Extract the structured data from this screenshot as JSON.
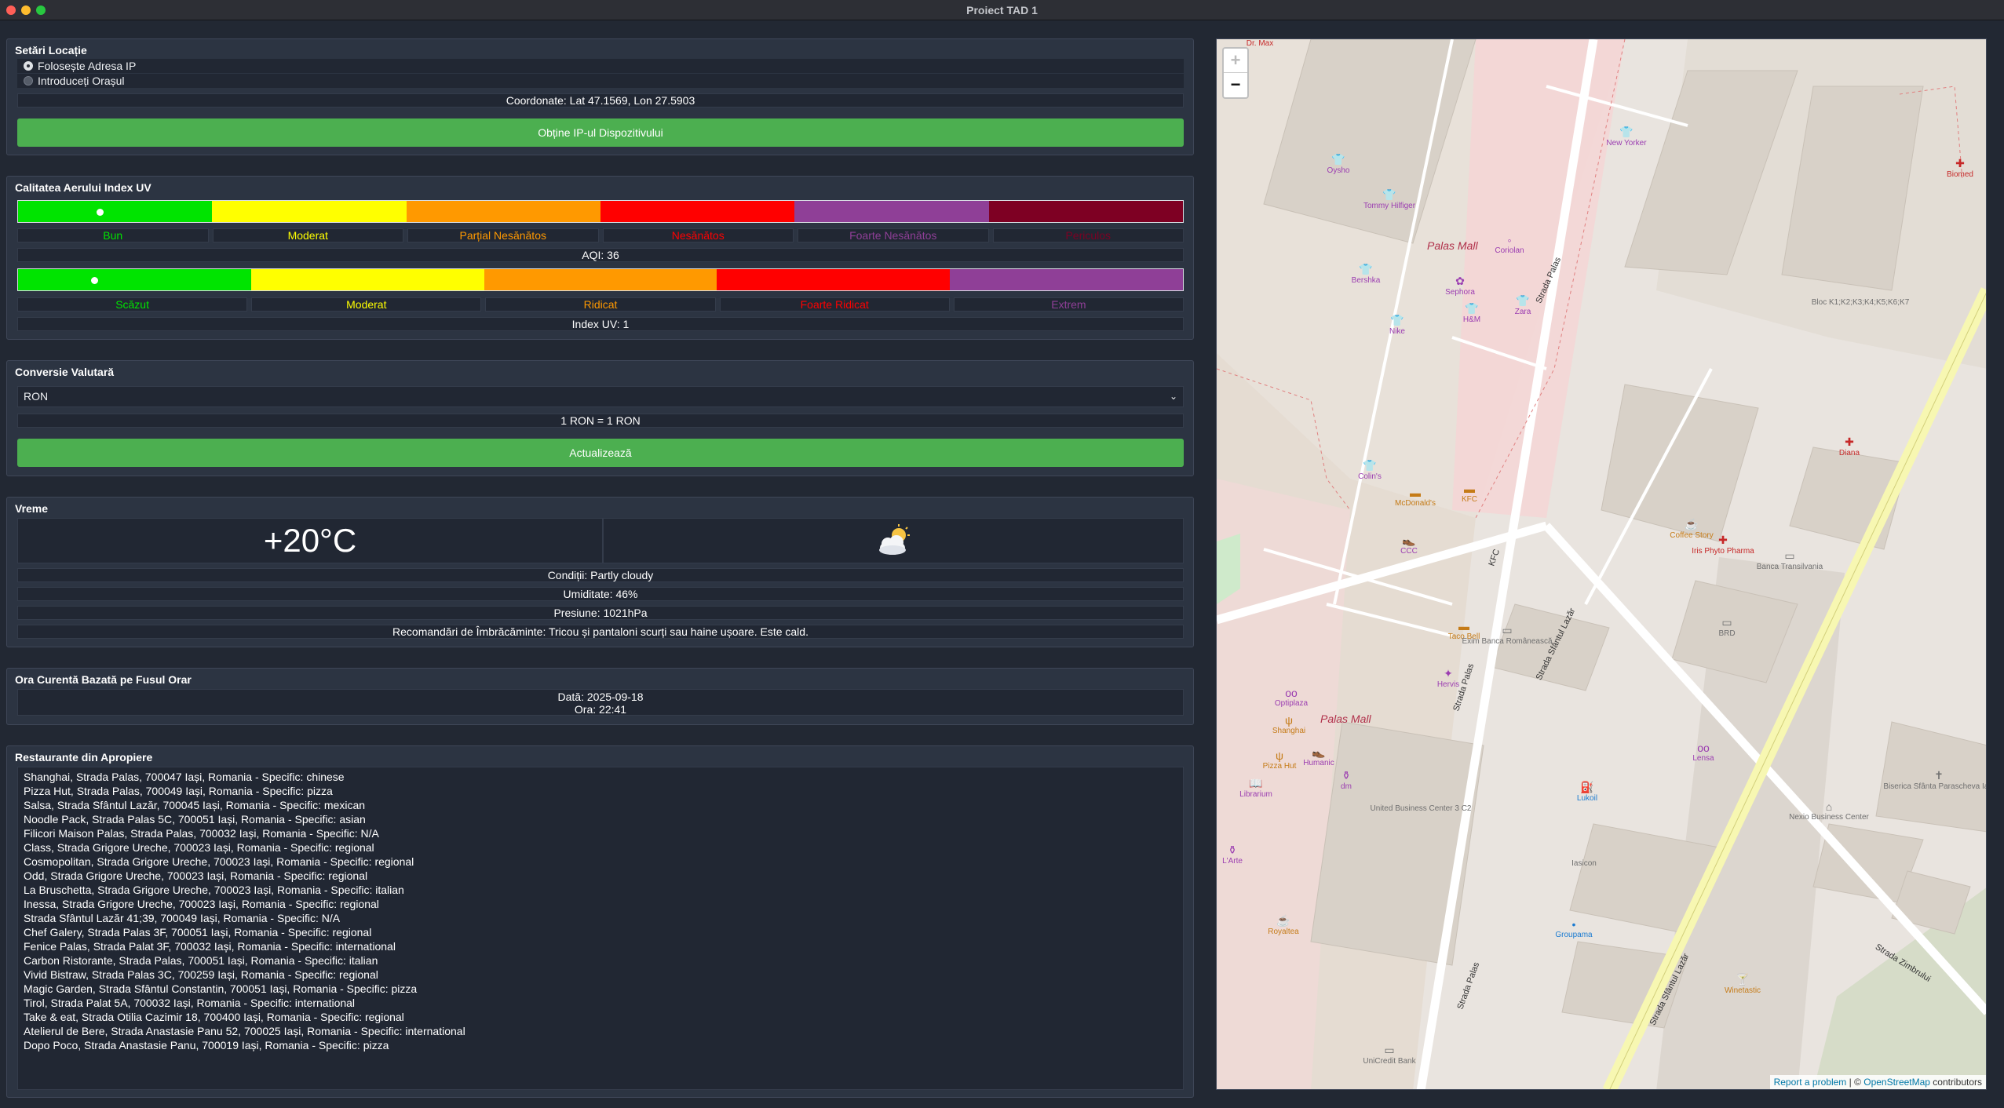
{
  "window": {
    "title": "Proiect TAD 1"
  },
  "location": {
    "title": "Setări Locație",
    "options": [
      "Folosește Adresa IP",
      "Introduceți Orașul"
    ],
    "coords": "Coordonate: Lat 47.1569, Lon 27.5903",
    "button": "Obține IP-ul Dispozitivului"
  },
  "air": {
    "title": "Calitatea Aerului  Index UV",
    "aqi_labels": [
      "Bun",
      "Moderat",
      "Parțial Nesănătos",
      "Nesănătos",
      "Foarte Nesănătos",
      "Periculos"
    ],
    "aqi_colors": [
      "#00e400",
      "#ffff00",
      "#ff9900",
      "#ff0000",
      "#8f3f97",
      "#7e0023"
    ],
    "aqi_text": "AQI: 36",
    "aqi_value": 36,
    "uv_labels": [
      "Scăzut",
      "Moderat",
      "Ridicat",
      "Foarte Ridicat",
      "Extrem"
    ],
    "uv_colors": [
      "#00e400",
      "#ffff00",
      "#ff9900",
      "#ff0000",
      "#8f3f97"
    ],
    "uv_text": "Index UV: 1",
    "uv_value": 1
  },
  "currency": {
    "title": "Conversie Valutară",
    "selected": "RON",
    "result": "1 RON = 1 RON",
    "button": "Actualizează"
  },
  "weather": {
    "title": "Vreme",
    "temperature": "+20°C",
    "icon_glyph": "⛅",
    "icon_name": "partly-cloudy-icon",
    "conditions": "Condiții: Partly cloudy",
    "humidity": "Umiditate: 46%",
    "pressure": "Presiune: 1021hPa",
    "recommendation": "Recomandări de Îmbrăcăminte: Tricou și pantaloni scurți sau haine ușoare. Este cald."
  },
  "time": {
    "title": "Ora Curentă Bazată pe Fusul Orar",
    "date": "Dată: 2025-09-18",
    "hour": "Ora: 22:41"
  },
  "restaurants": {
    "title": "Restaurante din Apropiere",
    "items": [
      "Shanghai, Strada Palas, 700047 Iași, Romania - Specific: chinese",
      "Pizza Hut, Strada Palas, 700049 Iași, Romania - Specific: pizza",
      "Salsa, Strada Sfântul Lazăr, 700045 Iași, Romania - Specific: mexican",
      "Noodle Pack, Strada Palas 5C, 700051 Iași, Romania - Specific: asian",
      "Filicori Maison Palas, Strada Palas, 700032 Iași, Romania - Specific: N/A",
      "Class, Strada Grigore Ureche, 700023 Iași, Romania - Specific: regional",
      "Cosmopolitan, Strada Grigore Ureche, 700023 Iași, Romania - Specific: regional",
      "Odd, Strada Grigore Ureche, 700023 Iași, Romania - Specific: regional",
      "La Bruschetta, Strada Grigore Ureche, 700023 Iași, Romania - Specific: italian",
      "Inessa, Strada Grigore Ureche, 700023 Iași, Romania - Specific: regional",
      "Strada Sfântul Lazăr 41;39, 700049 Iași, Romania - Specific: N/A",
      "Chef Galery, Strada Palas 3F, 700051 Iași, Romania - Specific: regional",
      "Fenice Palas, Strada Palat 3F, 700032 Iași, Romania - Specific: international",
      "Carbon Ristorante, Strada Palas, 700051 Iași, Romania - Specific: italian",
      "Vivid Bistraw, Strada Palas 3C, 700259 Iași, Romania - Specific: regional",
      "Magic Garden, Strada Sfântul Constantin, 700051 Iași, Romania - Specific: pizza",
      "Tirol, Strada Palat 5A, 700032 Iași, Romania - Specific: international",
      "Take & eat, Strada Otilia Cazimir 18, 700400 Iași, Romania - Specific: regional",
      "Atelierul de Bere, Strada Anastasie Panu 52, 700025 Iași, Romania - Specific: international",
      "Dopo Poco, Strada Anastasie Panu, 700019 Iași, Romania - Specific: pizza"
    ]
  },
  "map": {
    "zoom_in": "+",
    "zoom_out": "−",
    "attribution_link1": "Report a problem",
    "attribution_sep": " | © ",
    "attribution_link2": "OpenStreetMap",
    "attribution_tail": " contributors",
    "mall_label": "Palas Mall",
    "top_label": "Dr. Max",
    "streets": [
      "Strada Palas",
      "Strada Sfântul Lazăr",
      "Strada Zimbrului",
      "KFC"
    ],
    "pois": [
      {
        "name": "Oysho",
        "kind": "shop",
        "glyph": "👕"
      },
      {
        "name": "Tommy Hilfiger",
        "kind": "shop",
        "glyph": "👕"
      },
      {
        "name": "Bershka",
        "kind": "shop",
        "glyph": "👕"
      },
      {
        "name": "Nike",
        "kind": "shop",
        "glyph": "👕"
      },
      {
        "name": "Sephora",
        "kind": "shop",
        "glyph": "✿"
      },
      {
        "name": "H&M",
        "kind": "shop",
        "glyph": "👕"
      },
      {
        "name": "Zara",
        "kind": "shop",
        "glyph": "👕"
      },
      {
        "name": "Coriolan",
        "kind": "shop",
        "glyph": "◦"
      },
      {
        "name": "New Yorker",
        "kind": "shop",
        "glyph": "👕"
      },
      {
        "name": "Colin's",
        "kind": "shop",
        "glyph": "👕"
      },
      {
        "name": "McDonald's",
        "kind": "food",
        "glyph": "▬"
      },
      {
        "name": "KFC",
        "kind": "food",
        "glyph": "▬"
      },
      {
        "name": "CCC",
        "kind": "shop",
        "glyph": "👞"
      },
      {
        "name": "Taco Bell",
        "kind": "food",
        "glyph": "▬"
      },
      {
        "name": "Exim Banca Românească",
        "kind": "gray",
        "glyph": "▭"
      },
      {
        "name": "Hervis",
        "kind": "shop",
        "glyph": "✦"
      },
      {
        "name": "Optiplaza",
        "kind": "shop",
        "glyph": "oo"
      },
      {
        "name": "Shanghai",
        "kind": "food",
        "glyph": "ψ"
      },
      {
        "name": "Pizza Hut",
        "kind": "food",
        "glyph": "ψ"
      },
      {
        "name": "Humanic",
        "kind": "shop",
        "glyph": "👞"
      },
      {
        "name": "dm",
        "kind": "shop",
        "glyph": "⚱"
      },
      {
        "name": "Librarium",
        "kind": "shop",
        "glyph": "📖"
      },
      {
        "name": "L'Arte",
        "kind": "shop",
        "glyph": "⚱"
      },
      {
        "name": "Royaltea",
        "kind": "food",
        "glyph": "☕"
      },
      {
        "name": "UniCredit Bank",
        "kind": "gray",
        "glyph": "▭"
      },
      {
        "name": "Groupama",
        "kind": "blue",
        "glyph": "•"
      },
      {
        "name": "Lukoil",
        "kind": "blue",
        "glyph": "⛽"
      },
      {
        "name": "Iasicon",
        "kind": "gray",
        "glyph": ""
      },
      {
        "name": "Coffee Story",
        "kind": "food",
        "glyph": "☕"
      },
      {
        "name": "Iris Phyto Pharma",
        "kind": "red",
        "glyph": "✚"
      },
      {
        "name": "Banca Transilvania",
        "kind": "gray",
        "glyph": "▭"
      },
      {
        "name": "BRD",
        "kind": "gray",
        "glyph": "▭"
      },
      {
        "name": "Lensa",
        "kind": "shop",
        "glyph": "oo"
      },
      {
        "name": "Diana",
        "kind": "red",
        "glyph": "✚"
      },
      {
        "name": "Biomed",
        "kind": "red",
        "glyph": "✚"
      },
      {
        "name": "Bloc K1;K2;K3;K4;K5;K6;K7",
        "kind": "gray",
        "glyph": ""
      },
      {
        "name": "Nexio Business Center",
        "kind": "gray",
        "glyph": "⌂"
      },
      {
        "name": "United Business Center 3 C2",
        "kind": "gray",
        "glyph": ""
      },
      {
        "name": "Biserica Sfânta Parascheva Iași",
        "kind": "gray",
        "glyph": "✝"
      },
      {
        "name": "Winetastic",
        "kind": "food",
        "glyph": "🍸"
      }
    ]
  }
}
